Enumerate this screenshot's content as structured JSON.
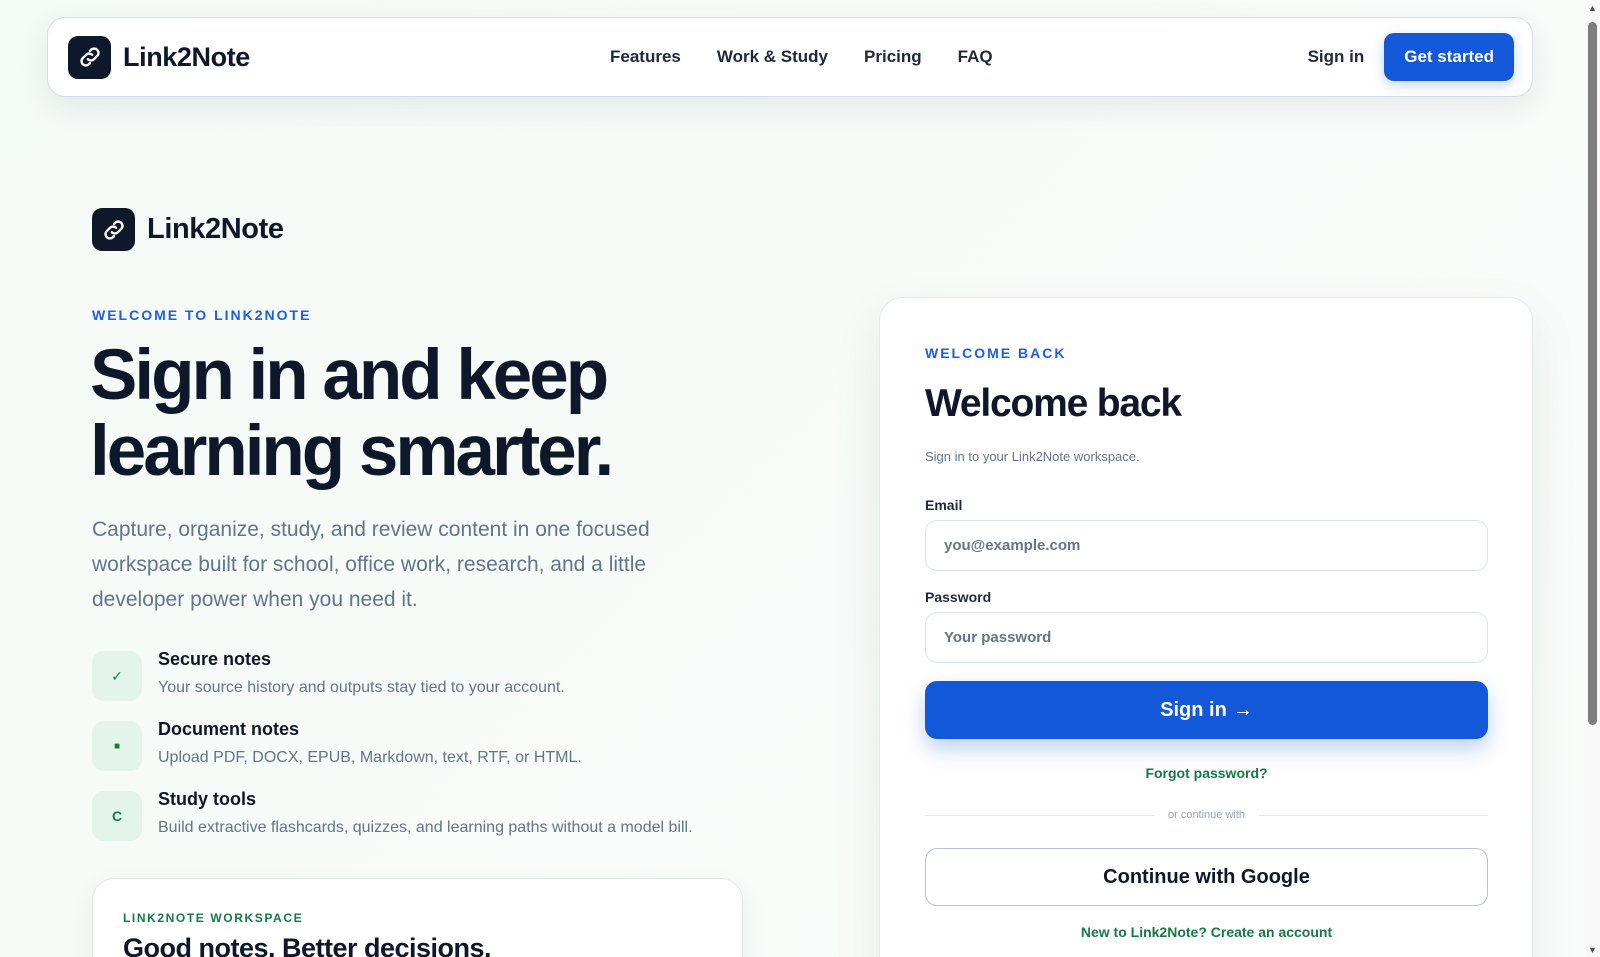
{
  "app": {
    "brand_name": "Link2Note"
  },
  "nav": {
    "links": [
      "Features",
      "Work & Study",
      "Pricing",
      "FAQ"
    ],
    "sign_in": "Sign in",
    "get_started": "Get started"
  },
  "hero": {
    "brand_name": "Link2Note",
    "eyebrow": "WELCOME TO LINK2NOTE",
    "title_line1": "Sign in and keep",
    "title_line2": "learning smarter.",
    "description": "Capture, organize, study, and review content in one focused workspace built for school, office work, research, and a little developer power when you need it.",
    "features": [
      {
        "icon": "✓",
        "icon_name": "check-icon",
        "title": "Secure notes",
        "desc": "Your source history and outputs stay tied to your account."
      },
      {
        "icon": "■",
        "icon_name": "document-icon",
        "title": "Document notes",
        "desc": "Upload PDF, DOCX, EPUB, Markdown, text, RTF, or HTML."
      },
      {
        "icon": "C",
        "icon_name": "study-icon",
        "title": "Study tools",
        "desc": "Build extractive flashcards, quizzes, and learning paths without a model bill."
      }
    ],
    "workspace_card": {
      "eyebrow": "LINK2NOTE WORKSPACE",
      "title": "Good notes. Better decisions."
    }
  },
  "signin": {
    "eyebrow": "WELCOME BACK",
    "title": "Welcome back",
    "subtitle": "Sign in to your Link2Note workspace.",
    "email_label": "Email",
    "email_placeholder": "you@example.com",
    "password_label": "Password",
    "password_placeholder": "Your password",
    "submit_label": "Sign in",
    "submit_arrow": "→",
    "forgot": "Forgot password?",
    "divider": "or continue with",
    "google": "Continue with Google",
    "create_account": "New to Link2Note? Create an account"
  },
  "colors": {
    "primary": "#1358d8",
    "accent_green": "#167a43",
    "dark": "#0f172a",
    "muted": "#64748b"
  }
}
